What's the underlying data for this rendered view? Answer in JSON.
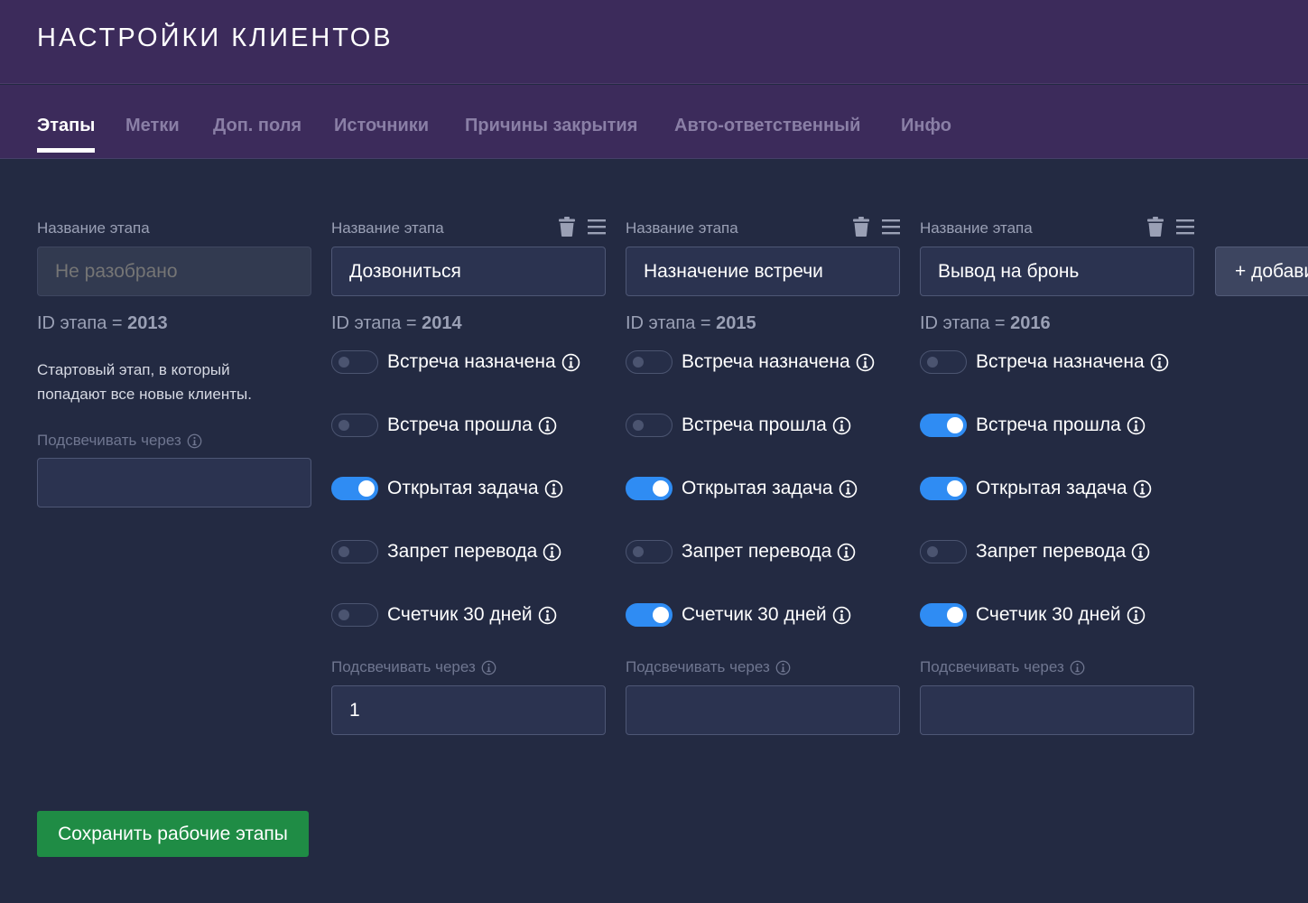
{
  "header": {
    "title": "НАСТРОЙКИ КЛИЕНТОВ"
  },
  "tabs": [
    {
      "label": "Этапы",
      "active": true
    },
    {
      "label": "Метки",
      "active": false
    },
    {
      "label": "Доп. поля",
      "active": false
    },
    {
      "label": "Источники",
      "active": false
    },
    {
      "label": "Причины закрытия",
      "active": false
    },
    {
      "label": "Авто-ответственный",
      "active": false
    },
    {
      "label": "Инфо",
      "active": false
    }
  ],
  "stages": [
    {
      "name_label": "Название этапа",
      "placeholder": "Не разобрано",
      "id_prefix": "ID этапа = ",
      "id": "2013",
      "description": "Стартовый этап, в который попадают все новые клиенты.",
      "highlight_label": "Подсвечивать через",
      "highlight_value": ""
    },
    {
      "name_label": "Название этапа",
      "value": "Дозвониться",
      "id_prefix": "ID этапа = ",
      "id": "2014",
      "toggles": [
        {
          "label": "Встреча назначена",
          "on": false
        },
        {
          "label": "Встреча прошла",
          "on": false
        },
        {
          "label": "Открытая задача",
          "on": true
        },
        {
          "label": "Запрет перевода",
          "on": false
        },
        {
          "label": "Счетчик 30 дней",
          "on": false
        }
      ],
      "highlight_label": "Подсвечивать через",
      "highlight_value": "1"
    },
    {
      "name_label": "Название этапа",
      "value": "Назначение встречи",
      "id_prefix": "ID этапа = ",
      "id": "2015",
      "toggles": [
        {
          "label": "Встреча назначена",
          "on": false
        },
        {
          "label": "Встреча прошла",
          "on": false
        },
        {
          "label": "Открытая задача",
          "on": true
        },
        {
          "label": "Запрет перевода",
          "on": false
        },
        {
          "label": "Счетчик 30 дней",
          "on": true
        }
      ],
      "highlight_label": "Подсвечивать через",
      "highlight_value": ""
    },
    {
      "name_label": "Название этапа",
      "value": "Вывод на бронь",
      "id_prefix": "ID этапа = ",
      "id": "2016",
      "toggles": [
        {
          "label": "Встреча назначена",
          "on": false
        },
        {
          "label": "Встреча прошла",
          "on": true
        },
        {
          "label": "Открытая задача",
          "on": true
        },
        {
          "label": "Запрет перевода",
          "on": false
        },
        {
          "label": "Счетчик 30 дней",
          "on": true
        }
      ],
      "highlight_label": "Подсвечивать через",
      "highlight_value": ""
    }
  ],
  "add_button": {
    "label": "+ добавить этап"
  },
  "save_button": {
    "label": "Сохранить рабочие этапы"
  },
  "colors": {
    "header_bg": "#3c2b5b",
    "page_bg": "#232a42",
    "toggle_on": "#2f8cf3",
    "save_green": "#1f8c45"
  }
}
